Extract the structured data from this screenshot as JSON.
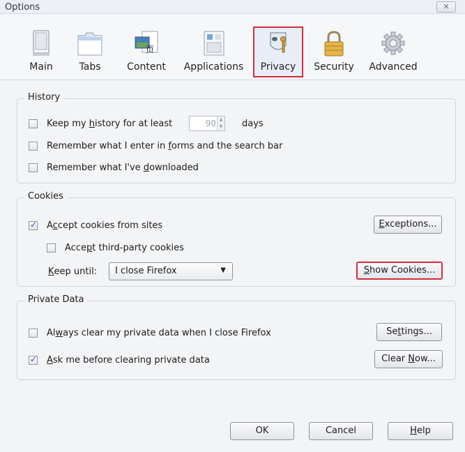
{
  "window": {
    "title": "Options",
    "close_icon": "✕"
  },
  "toolbar": {
    "items": [
      {
        "label": "Main"
      },
      {
        "label": "Tabs"
      },
      {
        "label": "Content"
      },
      {
        "label": "Applications"
      },
      {
        "label": "Privacy",
        "selected": true
      },
      {
        "label": "Security"
      },
      {
        "label": "Advanced"
      }
    ]
  },
  "history": {
    "title": "History",
    "keep_pre": "Keep my ",
    "keep_acc": "h",
    "keep_post": "istory for at least",
    "days_value": "90",
    "days_suffix": "days",
    "forms_pre": "Remember what I enter in ",
    "forms_acc": "f",
    "forms_post": "orms and the search bar",
    "down_pre": "Remember what I've ",
    "down_acc": "d",
    "down_post": "ownloaded"
  },
  "cookies": {
    "title": "Cookies",
    "accept_pre": "A",
    "accept_acc": "c",
    "accept_post": "cept cookies from sites",
    "accept_checked": true,
    "third_pre": "Acce",
    "third_acc": "p",
    "third_post": "t third-party cookies",
    "third_checked": false,
    "keep_acc": "K",
    "keep_post": "eep until:",
    "keep_value": "I close Firefox",
    "exceptions_acc": "E",
    "exceptions_post": "xceptions...",
    "show_acc": "S",
    "show_post": "how Cookies..."
  },
  "private": {
    "title": "Private Data",
    "always_pre": "Al",
    "always_acc": "w",
    "always_post": "ays clear my private data when I close Firefox",
    "always_checked": false,
    "ask_acc": "A",
    "ask_post": "sk me before clearing private data",
    "ask_checked": true,
    "settings_pre": "Se",
    "settings_acc": "t",
    "settings_post": "tings...",
    "clear_pre": "Clear ",
    "clear_acc": "N",
    "clear_post": "ow..."
  },
  "footer": {
    "ok": "OK",
    "cancel": "Cancel",
    "help_acc": "H",
    "help_post": "elp"
  },
  "colors": {
    "highlight": "#d22d3c",
    "background": "#f3f4f6"
  }
}
